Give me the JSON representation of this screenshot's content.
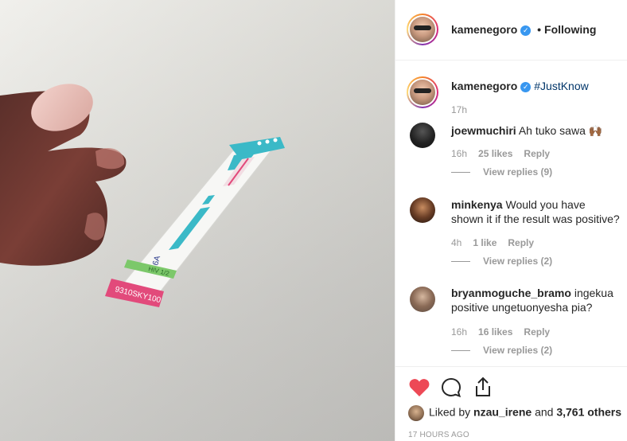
{
  "post": {
    "author": "kamenegoro",
    "separator": "•",
    "follow_status": "Following"
  },
  "caption": {
    "username": "kamenegoro",
    "hashtag": "#JustKnow",
    "time": "17h"
  },
  "comments": [
    {
      "username": "joewmuchiri",
      "text": "Ah tuko sawa",
      "emoji": "🙌🏾",
      "time": "16h",
      "likes": "25 likes",
      "reply": "Reply",
      "view_replies": "View replies (9)"
    },
    {
      "username": "minkenya",
      "text": "Would you have shown it if the result was positive?",
      "time": "4h",
      "likes": "1 like",
      "reply": "Reply",
      "view_replies": "View replies (2)"
    },
    {
      "username": "bryanmoguche_bramo",
      "text": "ingekua positive ungetuonyesha pia?",
      "time": "16h",
      "likes": "16 likes",
      "reply": "Reply",
      "view_replies": "View replies (2)"
    }
  ],
  "likes_line": {
    "prefix": "Liked by",
    "user": "nzau_irene",
    "middle": "and",
    "others": "3,761 others"
  },
  "timestamp": "17 HOURS AGO",
  "photo": {
    "strip_labels": [
      "6A",
      "HIV 1/2",
      "HIV 1/2"
    ],
    "strip_code": "9310SKY100"
  },
  "colors": {
    "heart": "#ed4956",
    "link": "#003569",
    "verified": "#3897f0",
    "strip_teal": "#3bb9c7",
    "strip_pink": "#e24a7b",
    "strip_green": "#7cc86a"
  },
  "icons": {
    "like": "heart-icon",
    "comment": "comment-icon",
    "share": "share-icon",
    "verified": "verified-badge-icon"
  }
}
